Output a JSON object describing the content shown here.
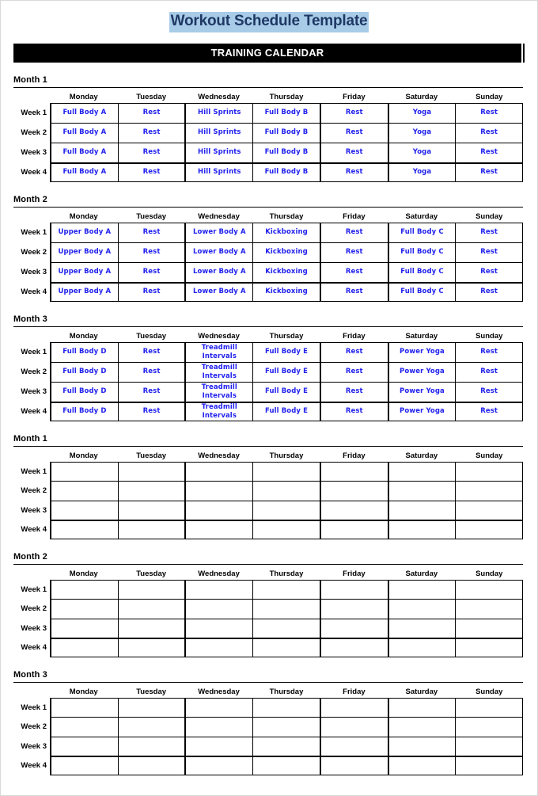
{
  "document": {
    "title": "Workout Schedule Template",
    "banner": "TRAINING CALENDAR",
    "title_highlight_color": "#a8cce8",
    "title_text_color": "#1f3864",
    "banner_bg_color": "#000000",
    "banner_text_color": "#ffffff",
    "entry_text_color": "#2222ee"
  },
  "day_headers": [
    "Monday",
    "Tuesday",
    "Wednesday",
    "Thursday",
    "Friday",
    "Saturday",
    "Sunday"
  ],
  "week_labels": [
    "Week 1",
    "Week 2",
    "Week 3",
    "Week 4"
  ],
  "sections": [
    {
      "label": "Month 1",
      "filled": true,
      "rows": [
        [
          "Full Body A",
          "Rest",
          "Hill Sprints",
          "Full Body B",
          "Rest",
          "Yoga",
          "Rest"
        ],
        [
          "Full Body A",
          "Rest",
          "Hill Sprints",
          "Full Body B",
          "Rest",
          "Yoga",
          "Rest"
        ],
        [
          "Full Body A",
          "Rest",
          "Hill Sprints",
          "Full Body B",
          "Rest",
          "Yoga",
          "Rest"
        ],
        [
          "Full Body A",
          "Rest",
          "Hill Sprints",
          "Full Body B",
          "Rest",
          "Yoga",
          "Rest"
        ]
      ]
    },
    {
      "label": "Month 2",
      "filled": true,
      "rows": [
        [
          "Upper Body A",
          "Rest",
          "Lower Body A",
          "Kickboxing",
          "Rest",
          "Full Body C",
          "Rest"
        ],
        [
          "Upper Body A",
          "Rest",
          "Lower Body A",
          "Kickboxing",
          "Rest",
          "Full Body C",
          "Rest"
        ],
        [
          "Upper Body A",
          "Rest",
          "Lower Body A",
          "Kickboxing",
          "Rest",
          "Full Body C",
          "Rest"
        ],
        [
          "Upper Body A",
          "Rest",
          "Lower Body A",
          "Kickboxing",
          "Rest",
          "Full Body C",
          "Rest"
        ]
      ]
    },
    {
      "label": "Month 3",
      "filled": true,
      "rows": [
        [
          "Full Body D",
          "Rest",
          "Treadmill\nIntervals",
          "Full Body E",
          "Rest",
          "Power Yoga",
          "Rest"
        ],
        [
          "Full Body D",
          "Rest",
          "Treadmill\nIntervals",
          "Full Body E",
          "Rest",
          "Power Yoga",
          "Rest"
        ],
        [
          "Full Body D",
          "Rest",
          "Treadmill\nIntervals",
          "Full Body E",
          "Rest",
          "Power Yoga",
          "Rest"
        ],
        [
          "Full Body D",
          "Rest",
          "Treadmill\nIntervals",
          "Full Body E",
          "Rest",
          "Power Yoga",
          "Rest"
        ]
      ]
    },
    {
      "label": "Month 1",
      "filled": false,
      "rows": [
        [
          "",
          "",
          "",
          "",
          "",
          "",
          ""
        ],
        [
          "",
          "",
          "",
          "",
          "",
          "",
          ""
        ],
        [
          "",
          "",
          "",
          "",
          "",
          "",
          ""
        ],
        [
          "",
          "",
          "",
          "",
          "",
          "",
          ""
        ]
      ]
    },
    {
      "label": "Month 2",
      "filled": false,
      "rows": [
        [
          "",
          "",
          "",
          "",
          "",
          "",
          ""
        ],
        [
          "",
          "",
          "",
          "",
          "",
          "",
          ""
        ],
        [
          "",
          "",
          "",
          "",
          "",
          "",
          ""
        ],
        [
          "",
          "",
          "",
          "",
          "",
          "",
          ""
        ]
      ]
    },
    {
      "label": "Month 3",
      "filled": false,
      "rows": [
        [
          "",
          "",
          "",
          "",
          "",
          "",
          ""
        ],
        [
          "",
          "",
          "",
          "",
          "",
          "",
          ""
        ],
        [
          "",
          "",
          "",
          "",
          "",
          "",
          ""
        ],
        [
          "",
          "",
          "",
          "",
          "",
          "",
          ""
        ]
      ]
    }
  ]
}
